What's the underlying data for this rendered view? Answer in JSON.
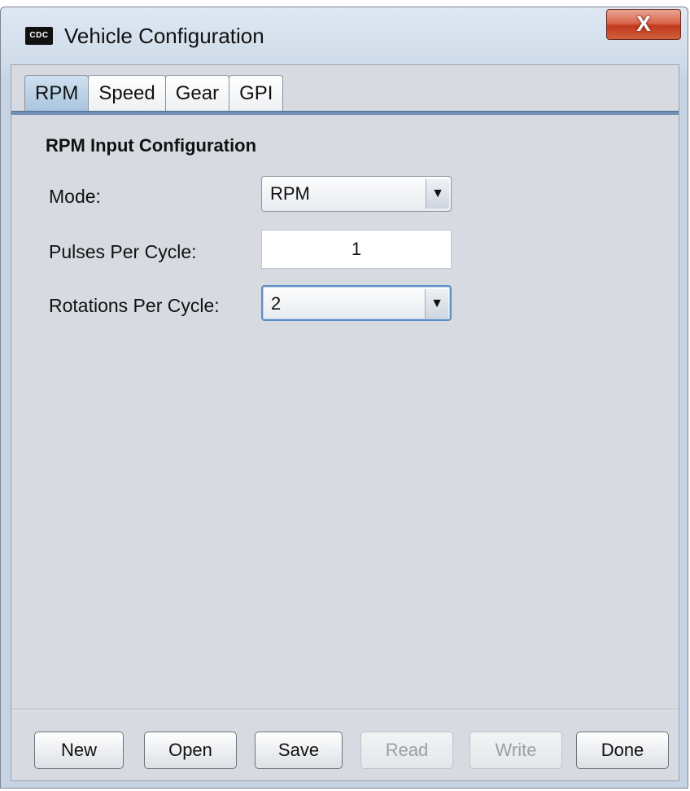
{
  "window": {
    "title": "Vehicle Configuration",
    "icon_text": "CDC",
    "close_label": "X"
  },
  "tabs": [
    {
      "label": "RPM",
      "active": true
    },
    {
      "label": "Speed",
      "active": false
    },
    {
      "label": "Gear",
      "active": false
    },
    {
      "label": "GPI",
      "active": false
    }
  ],
  "section": {
    "title": "RPM Input Configuration"
  },
  "fields": {
    "mode": {
      "label": "Mode:",
      "value": "RPM"
    },
    "pulses": {
      "label": "Pulses Per Cycle:",
      "value": "1"
    },
    "rotations": {
      "label": "Rotations Per Cycle:",
      "value": "2"
    }
  },
  "buttons": {
    "new": {
      "label": "New",
      "enabled": true
    },
    "open": {
      "label": "Open",
      "enabled": true
    },
    "save": {
      "label": "Save",
      "enabled": true
    },
    "read": {
      "label": "Read",
      "enabled": false
    },
    "write": {
      "label": "Write",
      "enabled": false
    },
    "done": {
      "label": "Done",
      "enabled": true
    }
  },
  "icons": {
    "dropdown_arrow": "▼"
  }
}
